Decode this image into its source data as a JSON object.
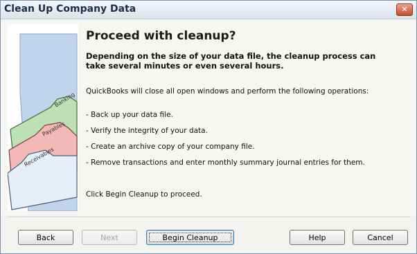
{
  "window": {
    "title": "Clean Up Company Data",
    "close_glyph": "✕"
  },
  "illustration": {
    "tabs": [
      "Banking",
      "Payables",
      "Receivables"
    ],
    "colors": {
      "panel": "#c0d4ec",
      "banking": "#bde0b5",
      "payables": "#f2b9b6",
      "receivables": "#e6eef7"
    }
  },
  "main": {
    "heading": "Proceed with cleanup?",
    "warning": "Depending on the size of your data file, the cleanup process can take several minutes or even several hours.",
    "intro": "QuickBooks will close all open windows and perform the following operations:",
    "operations": [
      "- Back up your data file.",
      "- Verify the integrity of your data.",
      "- Create an archive copy of your company file.",
      "- Remove transactions and enter monthly summary journal entries for them."
    ],
    "proceed": "Click Begin Cleanup to proceed."
  },
  "buttons": {
    "back": "Back",
    "next": "Next",
    "begin": "Begin Cleanup",
    "help": "Help",
    "cancel": "Cancel"
  }
}
